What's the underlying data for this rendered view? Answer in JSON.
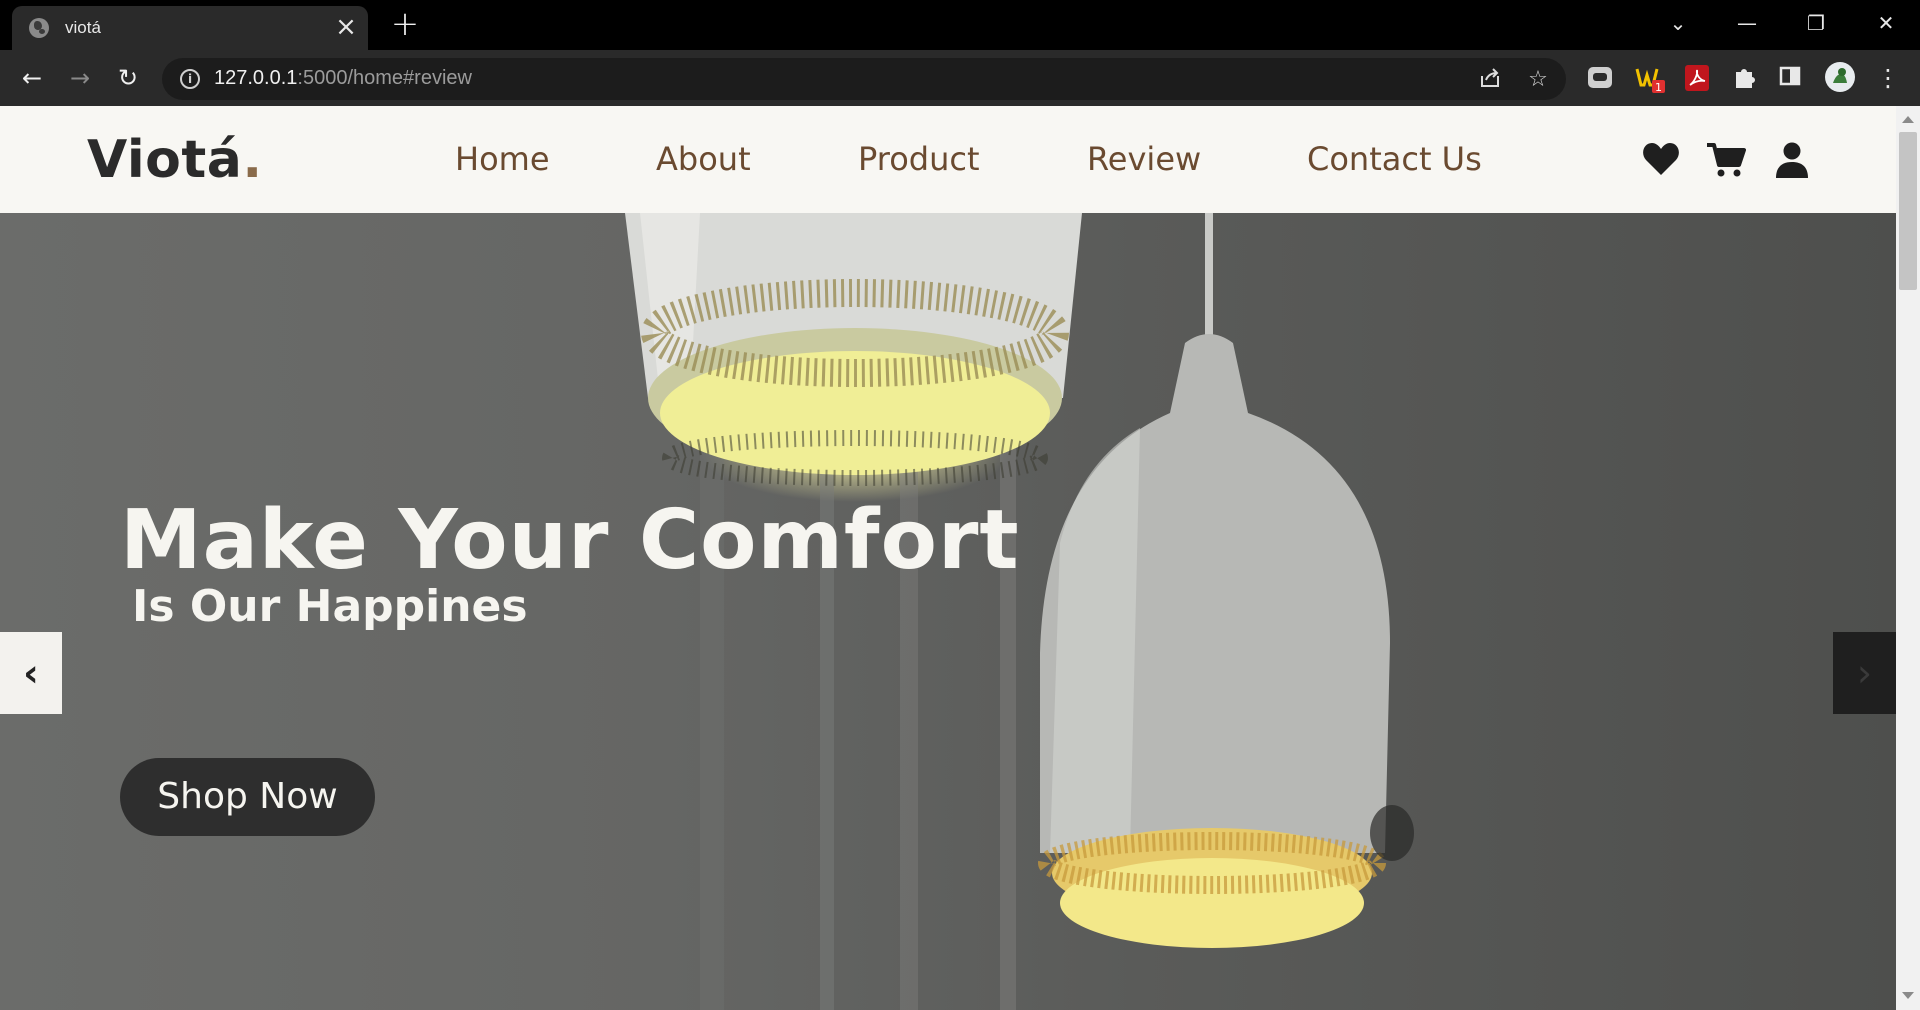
{
  "browser": {
    "tab_title": "viotá",
    "tab_close": "×",
    "new_tab": "+",
    "url_host": "127.0.0.1",
    "url_path": ":5000/home#review",
    "back": "←",
    "forward": "→",
    "reload": "↻",
    "window_controls": [
      "⌄",
      "—",
      "❐",
      "✕"
    ]
  },
  "site": {
    "logo_text": "Viotá",
    "logo_dot": ".",
    "nav": [
      "Home",
      "About",
      "Product",
      "Review",
      "Contact Us"
    ],
    "header_icons": [
      "heart-icon",
      "cart-icon",
      "user-icon"
    ]
  },
  "hero": {
    "title": "Make Your Comfort",
    "subtitle": "Is Our Happines",
    "cta": "Shop Now",
    "prev": "‹",
    "next": "›"
  },
  "colors": {
    "header_bg": "#f8f7f3",
    "nav_text": "#6a4a30",
    "logo_dot": "#8a6b4a",
    "cta_bg": "#2e2e2e"
  }
}
